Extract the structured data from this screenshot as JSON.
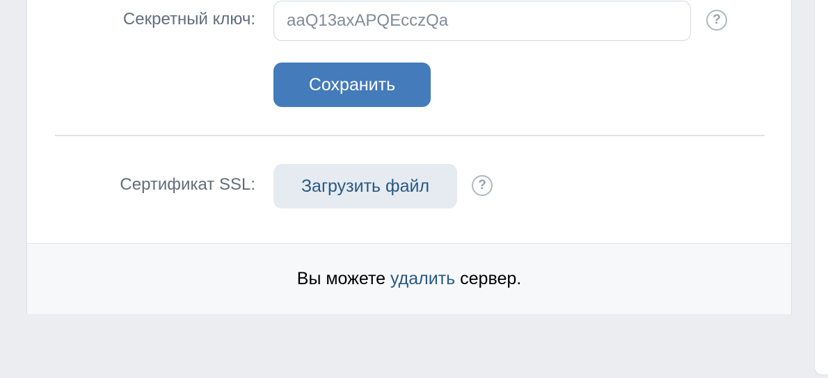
{
  "form": {
    "secret_key": {
      "label": "Секретный ключ:",
      "value": "aaQ13axAPQEcczQa",
      "help": "?"
    },
    "save_label": "Сохранить",
    "ssl": {
      "label": "Сертификат SSL:",
      "upload_label": "Загрузить файл",
      "help": "?"
    }
  },
  "footer": {
    "prefix": "Вы можете",
    "link": "удалить",
    "suffix": "сервер."
  },
  "colors": {
    "primary_button": "#447bba",
    "secondary_button": "#e5ebf1",
    "link": "#2a5885",
    "background": "#ebedf0"
  }
}
